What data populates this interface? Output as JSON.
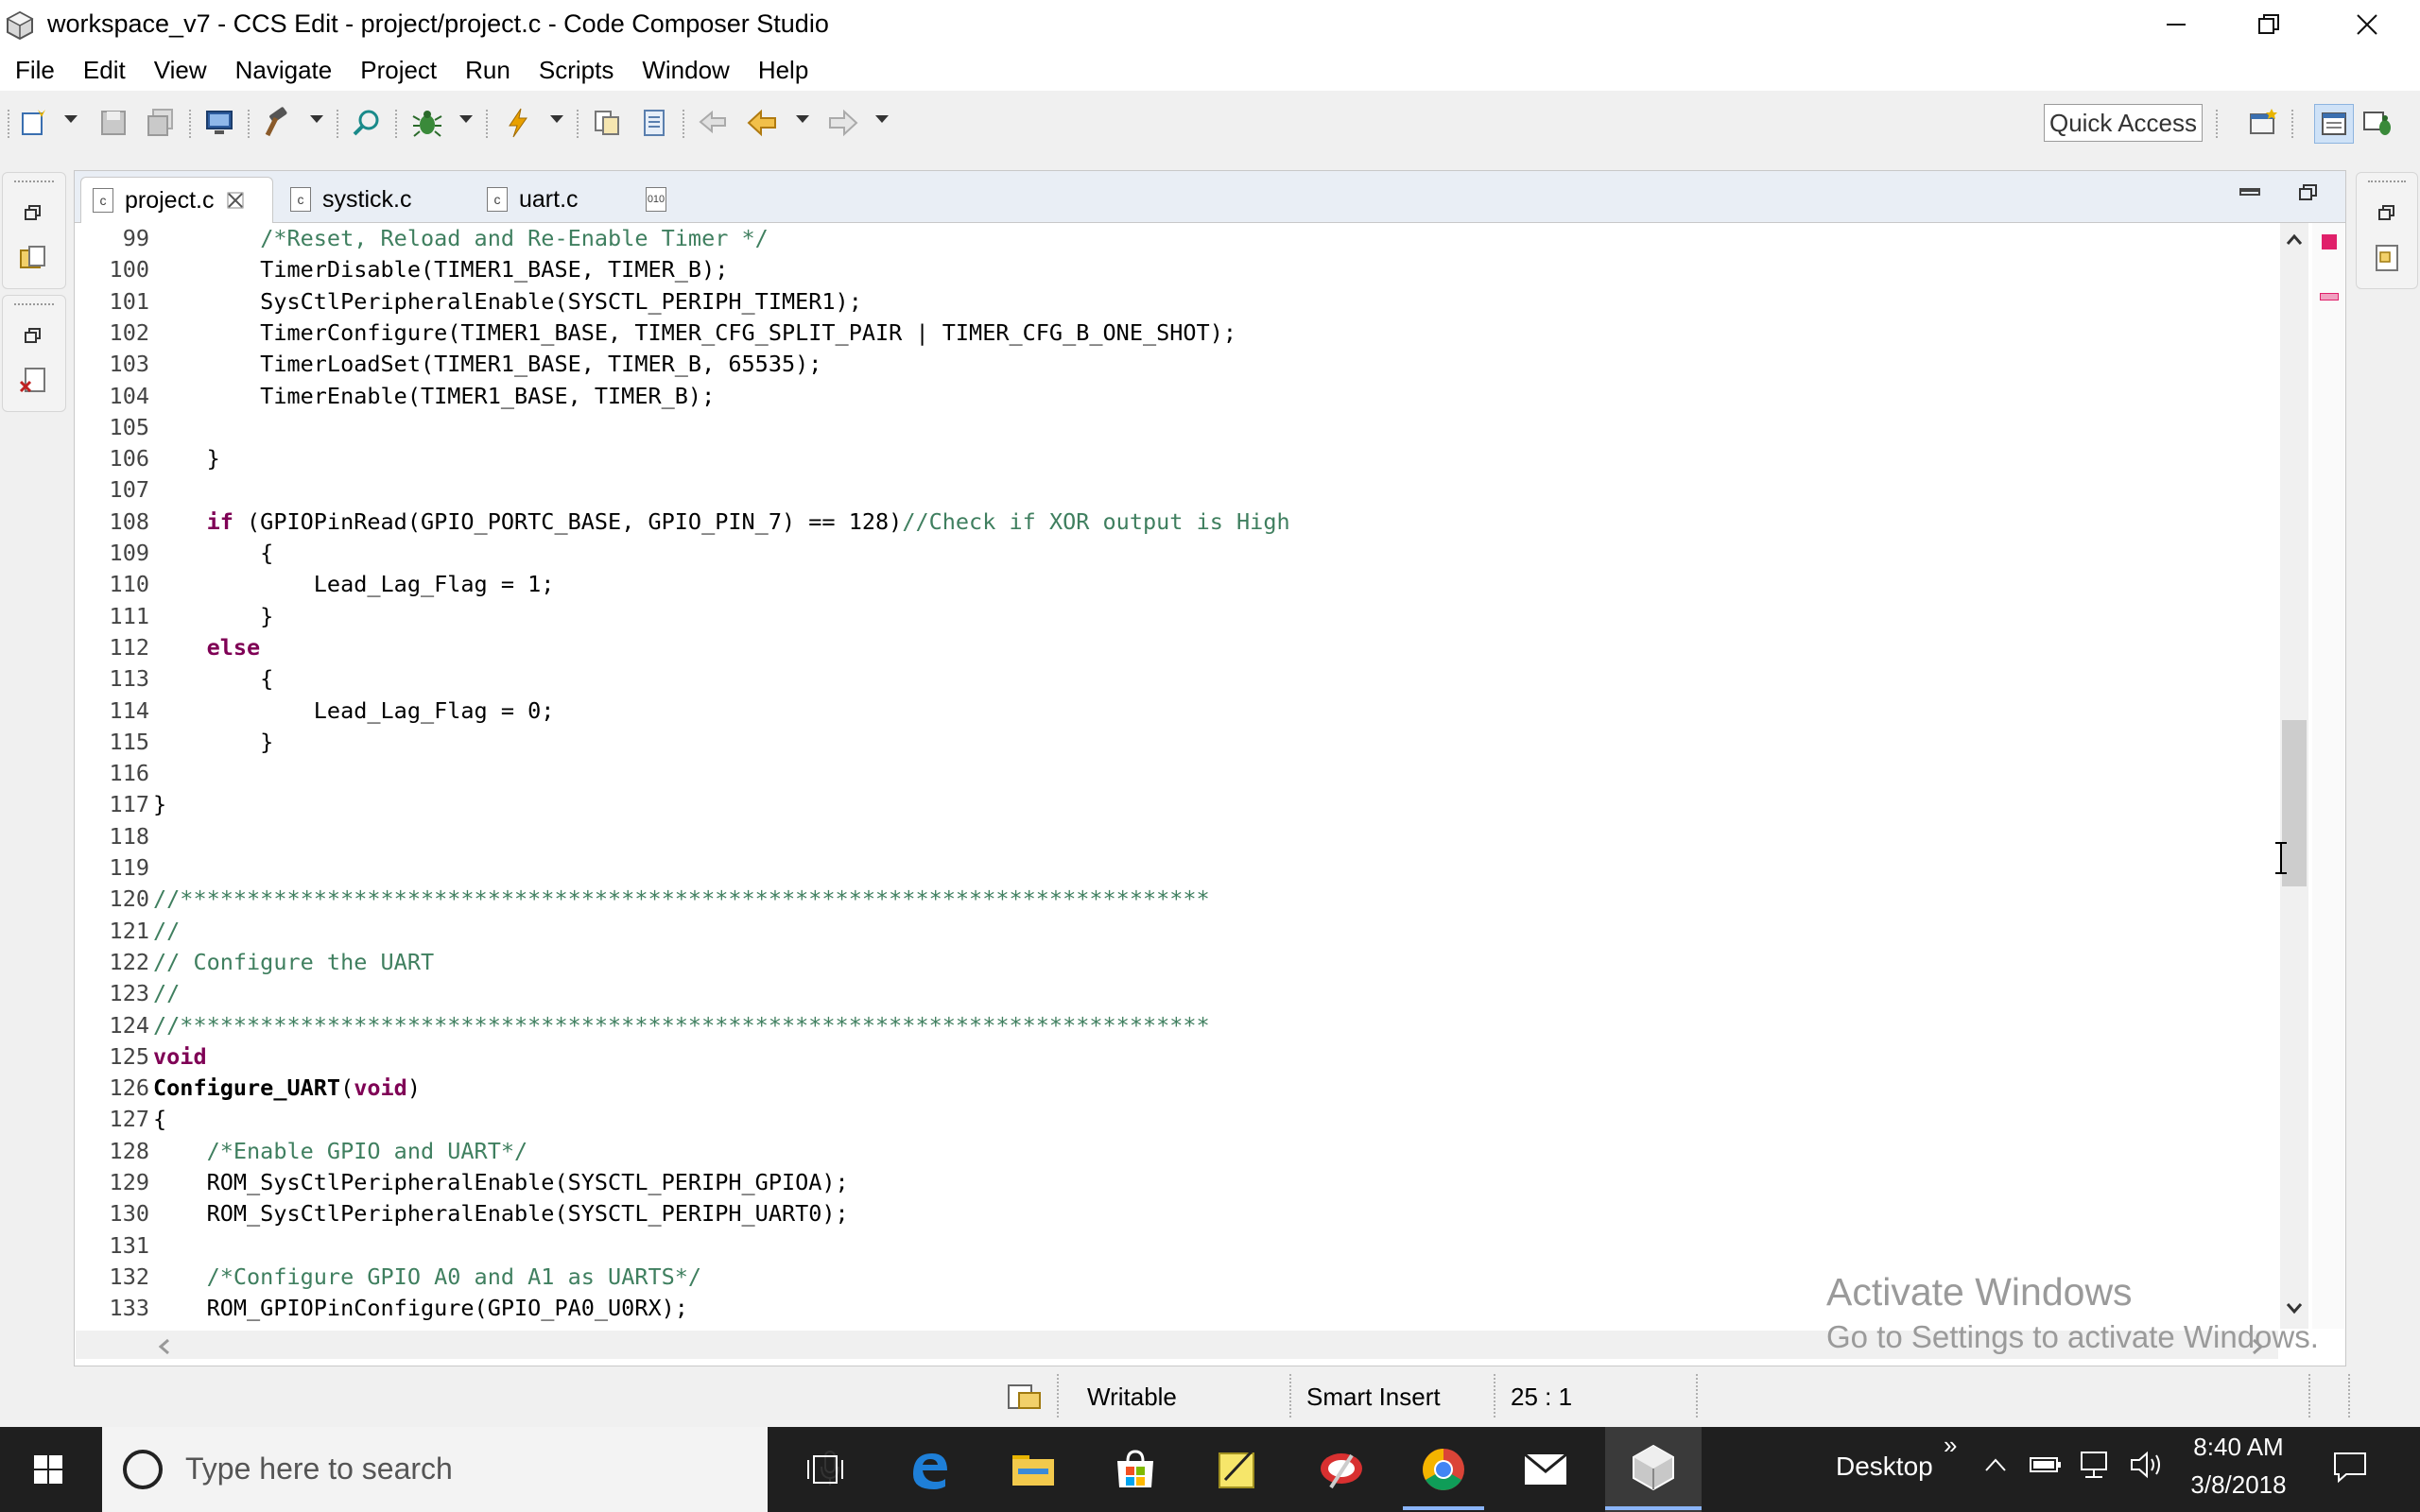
{
  "window": {
    "title": "workspace_v7 - CCS Edit - project/project.c - Code Composer Studio"
  },
  "menu": [
    "File",
    "Edit",
    "View",
    "Navigate",
    "Project",
    "Run",
    "Scripts",
    "Window",
    "Help"
  ],
  "toolbar": {
    "quick_access": "Quick Access"
  },
  "tabs": [
    {
      "label": "project.c",
      "icon": "c-file-icon",
      "active": true
    },
    {
      "label": "systick.c",
      "icon": "c-file-icon",
      "active": false
    },
    {
      "label": "uart.c",
      "icon": "c-file-icon",
      "active": false
    },
    {
      "label": "",
      "icon": "binary-file-icon",
      "active": false
    }
  ],
  "code": [
    {
      "n": "99",
      "p": [
        [
          "tx",
          "        "
        ],
        [
          "cm",
          "/*Reset, Reload and Re-Enable Timer */"
        ]
      ]
    },
    {
      "n": "100",
      "p": [
        [
          "tx",
          "        TimerDisable(TIMER1_BASE, TIMER_B);"
        ]
      ]
    },
    {
      "n": "101",
      "p": [
        [
          "tx",
          "        SysCtlPeripheralEnable(SYSCTL_PERIPH_TIMER1);"
        ]
      ]
    },
    {
      "n": "102",
      "p": [
        [
          "tx",
          "        TimerConfigure(TIMER1_BASE, TIMER_CFG_SPLIT_PAIR | TIMER_CFG_B_ONE_SHOT);"
        ]
      ]
    },
    {
      "n": "103",
      "p": [
        [
          "tx",
          "        TimerLoadSet(TIMER1_BASE, TIMER_B, 65535);"
        ]
      ]
    },
    {
      "n": "104",
      "p": [
        [
          "tx",
          "        TimerEnable(TIMER1_BASE, TIMER_B);"
        ]
      ]
    },
    {
      "n": "105",
      "p": []
    },
    {
      "n": "106",
      "p": [
        [
          "tx",
          "    }"
        ]
      ]
    },
    {
      "n": "107",
      "p": []
    },
    {
      "n": "108",
      "p": [
        [
          "tx",
          "    "
        ],
        [
          "kw",
          "if"
        ],
        [
          "tx",
          " (GPIOPinRead(GPIO_PORTC_BASE, GPIO_PIN_7) == 128)"
        ],
        [
          "cm",
          "//Check if XOR output is High"
        ]
      ]
    },
    {
      "n": "109",
      "p": [
        [
          "tx",
          "        {"
        ]
      ]
    },
    {
      "n": "110",
      "p": [
        [
          "tx",
          "            Lead_Lag_Flag = 1;"
        ]
      ]
    },
    {
      "n": "111",
      "p": [
        [
          "tx",
          "        }"
        ]
      ]
    },
    {
      "n": "112",
      "p": [
        [
          "tx",
          "    "
        ],
        [
          "kw",
          "else"
        ]
      ]
    },
    {
      "n": "113",
      "p": [
        [
          "tx",
          "        {"
        ]
      ]
    },
    {
      "n": "114",
      "p": [
        [
          "tx",
          "            Lead_Lag_Flag = 0;"
        ]
      ]
    },
    {
      "n": "115",
      "p": [
        [
          "tx",
          "        }"
        ]
      ]
    },
    {
      "n": "116",
      "p": []
    },
    {
      "n": "117",
      "p": [
        [
          "tx",
          "}"
        ]
      ]
    },
    {
      "n": "118",
      "p": []
    },
    {
      "n": "119",
      "p": []
    },
    {
      "n": "120",
      "p": [
        [
          "cm",
          "//*****************************************************************************"
        ]
      ]
    },
    {
      "n": "121",
      "p": [
        [
          "cm",
          "//"
        ]
      ]
    },
    {
      "n": "122",
      "p": [
        [
          "cm",
          "// Configure the UART"
        ]
      ]
    },
    {
      "n": "123",
      "p": [
        [
          "cm",
          "//"
        ]
      ]
    },
    {
      "n": "124",
      "p": [
        [
          "cm",
          "//*****************************************************************************"
        ]
      ]
    },
    {
      "n": "125",
      "p": [
        [
          "kw",
          "void"
        ]
      ]
    },
    {
      "n": "126",
      "p": [
        [
          "fn",
          "Configure_UART"
        ],
        [
          "tx",
          "("
        ],
        [
          "kw",
          "void"
        ],
        [
          "tx",
          ")"
        ]
      ]
    },
    {
      "n": "127",
      "p": [
        [
          "tx",
          "{"
        ]
      ]
    },
    {
      "n": "128",
      "p": [
        [
          "tx",
          "    "
        ],
        [
          "cm",
          "/*Enable GPIO and UART*/"
        ]
      ]
    },
    {
      "n": "129",
      "p": [
        [
          "tx",
          "    ROM_SysCtlPeripheralEnable(SYSCTL_PERIPH_GPIOA);"
        ]
      ]
    },
    {
      "n": "130",
      "p": [
        [
          "tx",
          "    ROM_SysCtlPeripheralEnable(SYSCTL_PERIPH_UART0);"
        ]
      ]
    },
    {
      "n": "131",
      "p": []
    },
    {
      "n": "132",
      "p": [
        [
          "tx",
          "    "
        ],
        [
          "cm",
          "/*Configure GPIO A0 and A1 as UARTS*/"
        ]
      ]
    },
    {
      "n": "133",
      "p": [
        [
          "tx",
          "    ROM_GPIOPinConfigure(GPIO_PA0_U0RX);"
        ]
      ]
    }
  ],
  "status": {
    "writable": "Writable",
    "insert_mode": "Smart Insert",
    "position": "25 : 1"
  },
  "watermark": {
    "line1": "Activate Windows",
    "line2": "Go to Settings to activate Windows."
  },
  "taskbar": {
    "search_placeholder": "Type here to search",
    "desktop_label": "Desktop",
    "time": "8:40 AM",
    "date": "3/8/2018"
  }
}
